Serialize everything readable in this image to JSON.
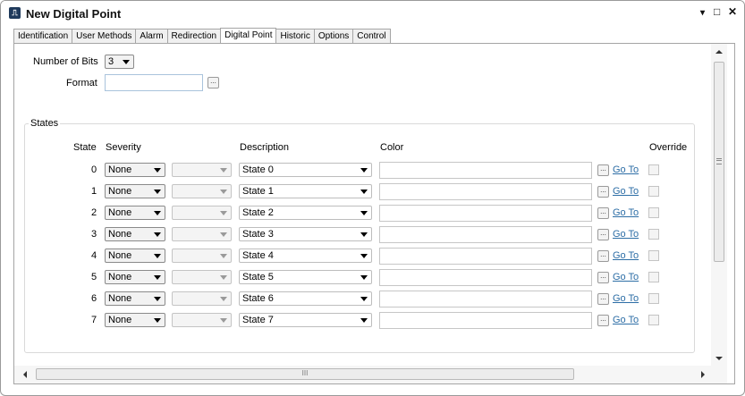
{
  "window": {
    "title": "New Digital Point"
  },
  "tabs": [
    {
      "label": "Identification"
    },
    {
      "label": "User Methods"
    },
    {
      "label": "Alarm"
    },
    {
      "label": "Redirection"
    },
    {
      "label": "Digital Point",
      "active": true
    },
    {
      "label": "Historic"
    },
    {
      "label": "Options"
    },
    {
      "label": "Control"
    }
  ],
  "form": {
    "bits_label": "Number of Bits",
    "bits_value": "3",
    "format_label": "Format",
    "format_value": "",
    "ellipsis": "..."
  },
  "states": {
    "group_title": "States",
    "headers": {
      "state": "State",
      "severity": "Severity",
      "description": "Description",
      "color": "Color",
      "override": "Override"
    },
    "rows": [
      {
        "state": "0",
        "severity": "None",
        "description": "State 0",
        "goto": "Go To"
      },
      {
        "state": "1",
        "severity": "None",
        "description": "State 1",
        "goto": "Go To"
      },
      {
        "state": "2",
        "severity": "None",
        "description": "State 2",
        "goto": "Go To"
      },
      {
        "state": "3",
        "severity": "None",
        "description": "State 3",
        "goto": "Go To"
      },
      {
        "state": "4",
        "severity": "None",
        "description": "State 4",
        "goto": "Go To"
      },
      {
        "state": "5",
        "severity": "None",
        "description": "State 5",
        "goto": "Go To"
      },
      {
        "state": "6",
        "severity": "None",
        "description": "State 6",
        "goto": "Go To"
      },
      {
        "state": "7",
        "severity": "None",
        "description": "State 7",
        "goto": "Go To"
      }
    ]
  },
  "scroll": {
    "grip": "III"
  },
  "colors": {
    "link": "#2d6ea6",
    "app_icon": "#1f3a5c"
  }
}
